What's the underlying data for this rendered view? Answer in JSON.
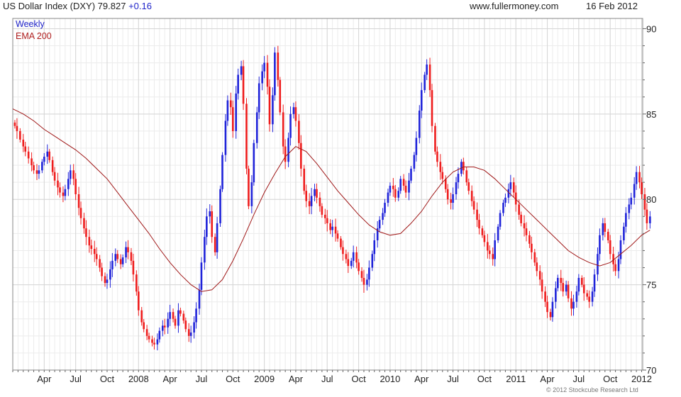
{
  "header": {
    "title": "US Dollar Index (DXY)",
    "last": "79.827",
    "change": "+0.16",
    "site": "www.fullermoney.com",
    "date": "16 Feb 2012"
  },
  "footer": {
    "copyright": "© 2012 Stockcube Research Ltd"
  },
  "colors": {
    "up": "#1f23d9",
    "down": "#ee1c1c",
    "ema": "#a01818",
    "grid": "#d6d6d6",
    "frame": "#888888"
  },
  "chart_data": {
    "type": "ohlc-bar",
    "legend": [
      "Weekly",
      "EMA 200"
    ],
    "ylim": [
      70,
      90.6
    ],
    "yticks": [
      70,
      75,
      80,
      85,
      90
    ],
    "x_range_months": [
      0,
      60.1
    ],
    "xticks": [
      {
        "m": 3,
        "label": "Apr"
      },
      {
        "m": 6,
        "label": "Jul"
      },
      {
        "m": 9,
        "label": "Oct"
      },
      {
        "m": 12,
        "label": "2008"
      },
      {
        "m": 15,
        "label": "Apr"
      },
      {
        "m": 18,
        "label": "Jul"
      },
      {
        "m": 21,
        "label": "Oct"
      },
      {
        "m": 24,
        "label": "2009"
      },
      {
        "m": 27,
        "label": "Apr"
      },
      {
        "m": 30,
        "label": "Jul"
      },
      {
        "m": 33,
        "label": "Oct"
      },
      {
        "m": 36,
        "label": "2010"
      },
      {
        "m": 39,
        "label": "Apr"
      },
      {
        "m": 42,
        "label": "Jul"
      },
      {
        "m": 45,
        "label": "Oct"
      },
      {
        "m": 48,
        "label": "2011"
      },
      {
        "m": 51,
        "label": "Apr"
      },
      {
        "m": 54,
        "label": "Jul"
      },
      {
        "m": 57,
        "label": "Oct"
      },
      {
        "m": 60,
        "label": "2012"
      }
    ],
    "series": [
      {
        "name": "Weekly",
        "note": "weekly closes (months since Jan 2007)",
        "x": [
          0.2,
          0.4,
          0.7,
          1.0,
          1.2,
          1.5,
          1.8,
          2.0,
          2.3,
          2.5,
          2.8,
          3.0,
          3.3,
          3.5,
          3.8,
          4.0,
          4.3,
          4.5,
          4.8,
          5.0,
          5.3,
          5.5,
          5.8,
          6.0,
          6.3,
          6.5,
          6.8,
          7.0,
          7.3,
          7.5,
          7.8,
          8.0,
          8.3,
          8.5,
          8.8,
          9.0,
          9.3,
          9.5,
          9.8,
          10.0,
          10.3,
          10.5,
          10.8,
          11.0,
          11.3,
          11.5,
          11.8,
          12.0,
          12.3,
          12.5,
          12.8,
          13.0,
          13.3,
          13.5,
          13.8,
          14.0,
          14.3,
          14.5,
          14.8,
          15.0,
          15.3,
          15.5,
          15.8,
          16.0,
          16.3,
          16.5,
          16.8,
          17.0,
          17.3,
          17.5,
          17.8,
          18.0,
          18.3,
          18.5,
          18.8,
          19.0,
          19.3,
          19.5,
          19.8,
          20.0,
          20.3,
          20.5,
          20.8,
          21.0,
          21.3,
          21.5,
          21.8,
          22.0,
          22.3,
          22.5,
          22.8,
          23.0,
          23.3,
          23.5,
          23.8,
          24.0,
          24.3,
          24.5,
          24.8,
          25.0,
          25.3,
          25.5,
          25.8,
          26.0,
          26.3,
          26.5,
          26.8,
          27.0,
          27.3,
          27.5,
          27.8,
          28.0,
          28.3,
          28.5,
          28.8,
          29.0,
          29.3,
          29.5,
          29.8,
          30.0,
          30.3,
          30.5,
          30.8,
          31.0,
          31.3,
          31.5,
          31.8,
          32.0,
          32.3,
          32.5,
          32.8,
          33.0,
          33.3,
          33.5,
          33.8,
          34.0,
          34.3,
          34.5,
          34.8,
          35.0,
          35.3,
          35.5,
          35.8,
          36.0,
          36.3,
          36.5,
          36.8,
          37.0,
          37.3,
          37.5,
          37.8,
          38.0,
          38.3,
          38.5,
          38.8,
          39.0,
          39.3,
          39.5,
          39.8,
          40.0,
          40.3,
          40.5,
          40.8,
          41.0,
          41.3,
          41.5,
          41.8,
          42.0,
          42.3,
          42.5,
          42.8,
          43.0,
          43.3,
          43.5,
          43.8,
          44.0,
          44.3,
          44.5,
          44.8,
          45.0,
          45.3,
          45.5,
          45.8,
          46.0,
          46.3,
          46.5,
          46.8,
          47.0,
          47.3,
          47.5,
          47.8,
          48.0,
          48.3,
          48.5,
          48.8,
          49.0,
          49.3,
          49.5,
          49.8,
          50.0,
          50.3,
          50.5,
          50.8,
          51.0,
          51.3,
          51.5,
          51.8,
          52.0,
          52.3,
          52.5,
          52.8,
          53.0,
          53.3,
          53.5,
          53.8,
          54.0,
          54.3,
          54.5,
          54.8,
          55.0,
          55.3,
          55.5,
          55.8,
          56.0,
          56.3,
          56.5,
          56.8,
          57.0,
          57.3,
          57.5,
          57.8,
          58.0,
          58.3,
          58.5,
          58.8,
          59.0,
          59.3,
          59.5,
          59.8,
          60.0,
          60.3,
          60.5,
          60.8
        ],
        "close": [
          84.3,
          84.0,
          83.5,
          83.1,
          82.8,
          82.4,
          82.0,
          81.7,
          81.5,
          81.7,
          82.2,
          82.5,
          82.8,
          82.3,
          81.6,
          81.1,
          80.7,
          80.4,
          80.2,
          80.6,
          81.2,
          81.7,
          81.2,
          80.3,
          79.5,
          78.9,
          78.3,
          77.8,
          77.3,
          77.1,
          76.8,
          76.5,
          76.0,
          75.5,
          75.1,
          75.3,
          75.9,
          76.4,
          76.8,
          76.5,
          76.2,
          76.6,
          77.2,
          76.9,
          76.4,
          75.6,
          74.6,
          73.5,
          72.8,
          72.4,
          72.0,
          71.8,
          71.6,
          71.5,
          71.8,
          72.3,
          72.6,
          72.5,
          73.0,
          73.4,
          73.0,
          72.6,
          73.5,
          73.3,
          72.9,
          72.4,
          72.0,
          72.2,
          72.8,
          73.6,
          74.7,
          76.3,
          77.8,
          79.0,
          79.3,
          77.8,
          76.9,
          78.6,
          80.6,
          82.6,
          84.6,
          85.8,
          85.4,
          84.0,
          86.2,
          87.3,
          87.8,
          85.6,
          81.8,
          79.6,
          81.0,
          83.3,
          85.1,
          86.8,
          87.5,
          88.0,
          86.6,
          84.4,
          86.1,
          88.6,
          87.0,
          85.1,
          83.1,
          82.2,
          83.6,
          85.0,
          85.4,
          84.6,
          83.3,
          81.8,
          80.5,
          79.9,
          79.6,
          80.2,
          80.6,
          80.1,
          79.6,
          79.1,
          78.9,
          78.6,
          78.2,
          78.4,
          78.0,
          77.7,
          77.2,
          76.8,
          76.5,
          76.1,
          76.4,
          76.9,
          76.3,
          75.8,
          75.4,
          75.0,
          75.3,
          76.0,
          76.8,
          77.6,
          78.3,
          78.8,
          79.2,
          79.8,
          80.4,
          80.8,
          80.6,
          80.1,
          80.5,
          81.2,
          80.8,
          80.4,
          81.1,
          81.8,
          82.6,
          83.6,
          85.2,
          86.4,
          87.3,
          87.9,
          86.4,
          84.3,
          82.8,
          82.2,
          81.6,
          81.2,
          80.6,
          80.0,
          79.8,
          80.3,
          81.0,
          81.5,
          82.2,
          81.7,
          81.0,
          80.5,
          79.9,
          79.4,
          78.8,
          78.3,
          77.9,
          77.5,
          77.0,
          76.8,
          76.5,
          77.6,
          78.4,
          79.2,
          79.8,
          80.1,
          80.6,
          81.0,
          80.4,
          79.7,
          79.1,
          78.6,
          78.3,
          77.9,
          77.4,
          76.9,
          76.3,
          75.8,
          75.3,
          74.6,
          74.0,
          73.4,
          73.1,
          74.0,
          74.8,
          75.4,
          75.1,
          74.6,
          75.0,
          74.2,
          73.6,
          74.0,
          74.6,
          75.4,
          75.0,
          74.5,
          74.3,
          74.0,
          74.6,
          75.6,
          76.8,
          77.9,
          78.6,
          78.1,
          77.6,
          76.8,
          76.2,
          75.8,
          76.5,
          77.6,
          78.4,
          79.2,
          79.7,
          80.1,
          80.9,
          81.6,
          81.0,
          80.3,
          79.4,
          78.6,
          79.0,
          79.3,
          79.6,
          79.8
        ]
      },
      {
        "name": "EMA 200",
        "x": [
          0,
          1,
          2,
          3,
          4,
          5,
          6,
          7,
          8,
          9,
          10,
          11,
          12,
          13,
          14,
          15,
          16,
          17,
          18,
          19,
          20,
          21,
          22,
          23,
          24,
          25,
          26,
          27,
          28,
          29,
          30,
          31,
          32,
          33,
          34,
          35,
          36,
          37,
          38,
          39,
          40,
          41,
          42,
          43,
          44,
          45,
          46,
          47,
          48,
          49,
          50,
          51,
          52,
          53,
          54,
          55,
          56,
          57,
          58,
          59,
          60,
          60.8
        ],
        "y": [
          85.3,
          85.0,
          84.6,
          84.1,
          83.7,
          83.3,
          82.9,
          82.4,
          81.8,
          81.2,
          80.4,
          79.6,
          78.8,
          78.0,
          77.1,
          76.3,
          75.6,
          75.0,
          74.6,
          74.7,
          75.3,
          76.4,
          77.7,
          79.1,
          80.4,
          81.5,
          82.5,
          83.1,
          82.8,
          82.1,
          81.3,
          80.5,
          79.8,
          79.1,
          78.5,
          78.1,
          77.9,
          78.0,
          78.6,
          79.3,
          80.2,
          81.0,
          81.6,
          81.9,
          81.9,
          81.7,
          81.2,
          80.6,
          80.0,
          79.4,
          78.8,
          78.2,
          77.6,
          77.0,
          76.6,
          76.3,
          76.1,
          76.3,
          76.8,
          77.3,
          77.9,
          78.2
        ]
      }
    ]
  }
}
